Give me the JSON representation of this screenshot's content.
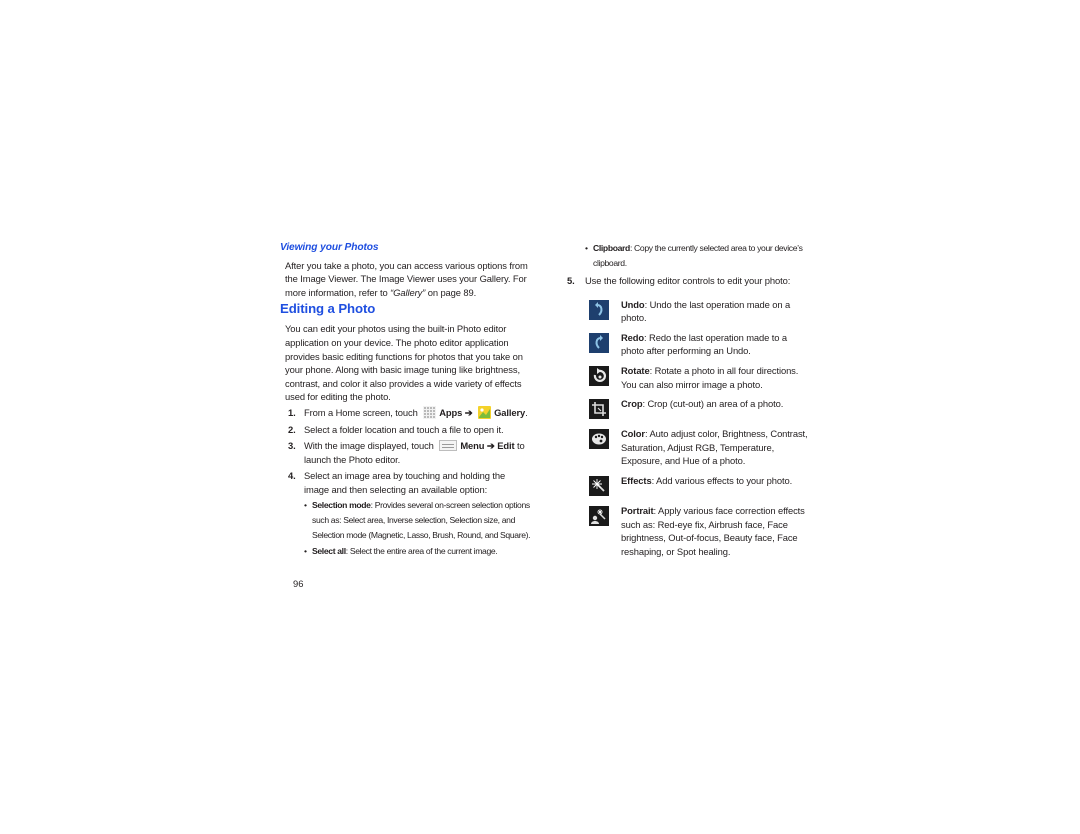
{
  "left": {
    "heading_viewing": "Viewing your Photos",
    "viewing_para": "After you take a photo, you can access various options from the Image Viewer. The Image Viewer uses your Gallery. For more information, refer to ",
    "viewing_link": "“Gallery”",
    "viewing_suffix": " on page 89.",
    "heading_editing": "Editing a Photo",
    "editing_para": "You can edit your photos using the built-in Photo editor application on your device. The photo editor application provides basic editing functions for photos that you take on your phone. Along with basic image tuning like brightness, contrast, and color it also provides a wide variety of effects used for editing the photo.",
    "steps": [
      {
        "num": "1.",
        "pre": "From a Home screen, touch",
        "apps": "Apps",
        "arrow": "➔",
        "gallery": "Gallery",
        "end": "."
      },
      {
        "num": "2.",
        "text": "Select a folder location and touch a file to open it."
      },
      {
        "num": "3.",
        "pre": "With the image displayed, touch",
        "menu": "Menu",
        "arrow": "➔",
        "edit": "Edit",
        "post": " to launch the Photo editor."
      },
      {
        "num": "4.",
        "text": "Select an image area by touching and holding the image and then selecting an available option:",
        "bullets": [
          {
            "term": "Selection mode",
            "desc": ": Provides several on-screen selection options such as: Select area, Inverse selection, Selection size, and Selection mode (Magnetic, Lasso, Brush, Round, and Square)."
          },
          {
            "term": "Select all",
            "desc": ": Select the entire area of the current image."
          }
        ]
      }
    ],
    "page_number": "96"
  },
  "right": {
    "bullet_clipboard": {
      "term": "Clipboard",
      "desc": ": Copy the currently selected area to your device’s clipboard."
    },
    "step5": {
      "num": "5.",
      "text": "Use the following editor controls to edit your photo:"
    },
    "controls": [
      {
        "icon": "undo-icon",
        "term": "Undo",
        "desc": ": Undo the last operation made on a photo."
      },
      {
        "icon": "redo-icon",
        "term": "Redo",
        "desc": ": Redo the last operation made to a photo after performing an Undo."
      },
      {
        "icon": "rotate-icon",
        "term": "Rotate",
        "desc": ": Rotate a photo in all four directions. You can also mirror image a photo."
      },
      {
        "icon": "crop-icon",
        "term": "Crop",
        "desc": ": Crop (cut-out) an area of a photo."
      },
      {
        "icon": "color-palette-icon",
        "term": "Color",
        "desc": ": Auto adjust color, Brightness, Contrast, Saturation, Adjust RGB, Temperature, Exposure, and Hue of a photo."
      },
      {
        "icon": "effects-wand-icon",
        "term": "Effects",
        "desc": ": Add various effects to your photo."
      },
      {
        "icon": "portrait-icon",
        "term": "Portrait",
        "desc": ": Apply various face correction effects such as: Red-eye fix, Airbrush face, Face brightness, Out-of-focus, Beauty face, Face reshaping, or Spot healing."
      }
    ]
  },
  "colors": {
    "heading": "#1f4fe0",
    "body_text": "#231f20",
    "undo_redo_bg": "#1e3f6e",
    "tool_bg": "#1a1a1a"
  }
}
